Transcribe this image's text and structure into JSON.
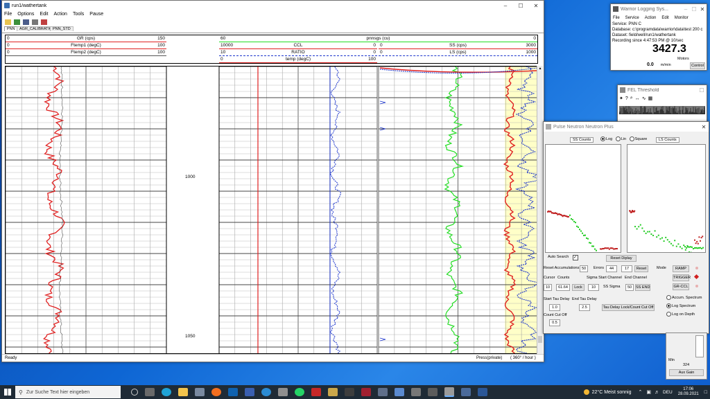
{
  "colors": {
    "gr": "#e02020",
    "ftemp": "#555555",
    "ccl": "#e02020",
    "ratio": "#1a33cc",
    "ss": "#22dd22",
    "ls": "#1a33cc",
    "temp": "#e02020",
    "fill": "#ffffc8"
  },
  "main": {
    "title": "run1/wathertank",
    "menu": [
      "File",
      "Options",
      "Edit",
      "Action",
      "Tools",
      "Pause"
    ],
    "tabs": [
      "PNN",
      "AGR_CALIBRATION",
      "PNN_STD"
    ],
    "headers": {
      "gr": {
        "min": "0",
        "name": "GR (cps)",
        "max": "150"
      },
      "ftemp1": {
        "min": "0",
        "name": "Ftemp1 (degC)",
        "max": "100"
      },
      "ftemp2": {
        "min": "0",
        "name": "Ftemp2 (degC)",
        "max": "100"
      },
      "pnnsgs": {
        "min": "60",
        "name": "pnnsgs (cu)",
        "max": "0"
      },
      "ccl": {
        "min": "10000",
        "name": "CCL",
        "max": "0"
      },
      "ratio": {
        "min": "10",
        "name": "RATIO",
        "max": "0"
      },
      "temp": {
        "min": "0",
        "name": "temp (degC)",
        "max": "100"
      },
      "ss": {
        "min": "0",
        "name": "SS (cps)",
        "max": "3000"
      },
      "ls": {
        "min": "0",
        "name": "LS (cps)",
        "max": "1000"
      }
    },
    "depths": [
      "1000",
      "1050"
    ],
    "status": {
      "left": "Ready",
      "mid": "Press(private)",
      "right": "( 360° / hour )"
    }
  },
  "logging": {
    "title": "Warrior Logging Sys...",
    "menu": [
      "File",
      "Service",
      "Action",
      "Edit",
      "Monitor"
    ],
    "service": "Service:  PNN C",
    "database": "Database:  c:\\programdata\\warrior\\data\\test 200 c",
    "dataset": "Dataset:   field/well/run1/wathertank",
    "recording": "Recording since 4:47:53 PM @ 10/sec",
    "depth": "3427.3",
    "motors": "Motors",
    "speed": "0.0",
    "speed_unit": "m/min",
    "control": "Control"
  },
  "threshold": {
    "title": "FEL Threshold"
  },
  "pnn": {
    "title": "Pulse Neutron Neutron Plus",
    "ss_label": "SS Counts",
    "ls_label": "LS Counts",
    "radios": [
      "Log",
      "Lin",
      "Square"
    ],
    "auto_search": "Auto Search",
    "reset_display": "Reset Diplay",
    "reset_acc": "Reset Accumulations",
    "reset_acc_val": "50",
    "errors_label": "Errors",
    "errors_a": "44",
    "errors_b": "17",
    "reset": "Reset",
    "mode": "Mode",
    "ramp": "RAMP",
    "trigger": "TRIGGER",
    "grccl": "GR-CCL",
    "cursor": "Cursor",
    "counts": "Counts",
    "cursor_val": "10",
    "counts_val": "61.64",
    "lock": "Lock",
    "sigma_start": "Sigma Start Channel",
    "end_channel": "End Channel",
    "sigma_start_val": "10",
    "ss_sigma": "SS Sigma",
    "end_val": "50",
    "ss_end": "SS END",
    "start_tau": "Start Tau Delay",
    "start_tau_val": "1.0",
    "end_tau": "End Tau Delay",
    "end_tau_val": "2.5",
    "tau_lock": "Tau Delay Lock/Count Cut Off",
    "count_cut": "Count Cut Off",
    "count_cut_val": "0.5",
    "spectrum": [
      "Accum. Spectrum",
      "Log Spectrum",
      "Log on Depth"
    ],
    "min": "Min",
    "min_val": "324",
    "aux_gain": "Aux Gain"
  },
  "taskbar": {
    "search": "Zur Suche Text hier eingeben",
    "weather": "22°C  Meist sonnig",
    "lang": "DEU",
    "time": "17:06",
    "date": "28.09.2021"
  }
}
